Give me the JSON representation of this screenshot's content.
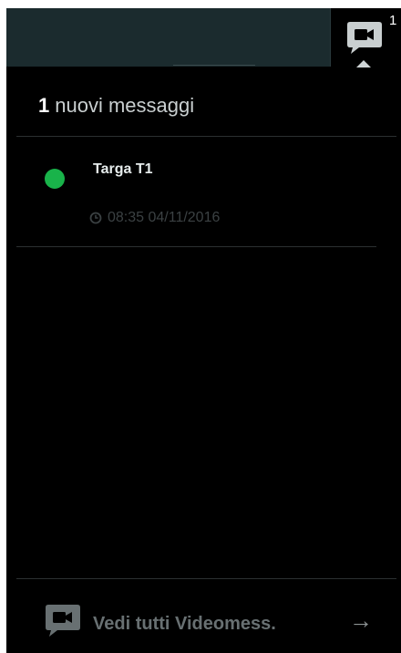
{
  "topbar": {
    "notification_icon": "video-message-icon",
    "notification_count": "1"
  },
  "dropdown": {
    "header_count": "1",
    "header_text": "nuovi messaggi",
    "messages": [
      {
        "title": "Targa T1",
        "time": "08:35 04/11/2016",
        "status_color": "#19b34a"
      }
    ],
    "footer": {
      "icon": "video-message-icon",
      "label": "Vedi tutti Videomess.",
      "arrow": "→"
    }
  },
  "colors": {
    "topbar_bg": "#1b2b2e",
    "panel_bg": "#000000",
    "accent_icon": "#c9cfd0",
    "status_online": "#19b34a"
  }
}
